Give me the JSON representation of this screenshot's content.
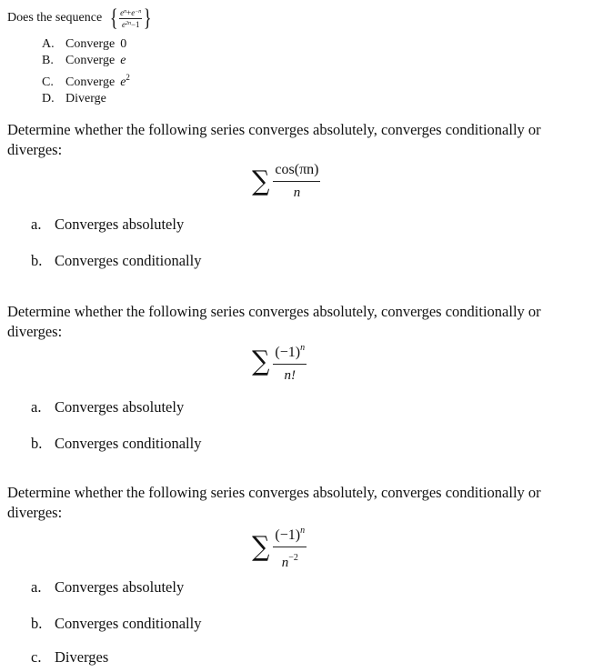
{
  "question1": {
    "stem": "Does the sequence",
    "sequence": {
      "numerator_term1": "e",
      "numerator_term1_exp": "n",
      "numerator_op": "+",
      "numerator_term2": "e",
      "numerator_term2_exp": "−n",
      "denominator_term": "e",
      "denominator_exp": "2n",
      "denominator_tail": "−1"
    },
    "options": [
      {
        "letter": "A.",
        "label": "Converge",
        "math": "0",
        "sup": ""
      },
      {
        "letter": "B.",
        "label": "Converge",
        "math": "e",
        "sup": ""
      },
      {
        "letter": "C.",
        "label": "Converge",
        "math": "e",
        "sup": "2"
      },
      {
        "letter": "D.",
        "label": "Diverge",
        "math": "",
        "sup": ""
      }
    ]
  },
  "question2": {
    "stem": "Determine whether the following series converges absolutely, converges conditionally or diverges:",
    "sigma": "∑",
    "numerator": "cos(πn)",
    "numerator_sup": "",
    "denominator": "n",
    "denominator_sup": "",
    "choices": [
      {
        "letter": "a.",
        "label": "Converges absolutely"
      },
      {
        "letter": "b.",
        "label": "Converges conditionally"
      }
    ]
  },
  "question3": {
    "stem": "Determine whether the following series converges absolutely, converges conditionally or diverges:",
    "sigma": "∑",
    "numerator": "(−1)",
    "numerator_sup": "n",
    "denominator": "n!",
    "denominator_sup": "",
    "choices": [
      {
        "letter": "a.",
        "label": "Converges absolutely"
      },
      {
        "letter": "b.",
        "label": "Converges conditionally"
      }
    ]
  },
  "question4": {
    "stem": "Determine whether the following series converges absolutely, converges conditionally or diverges:",
    "sigma": "∑",
    "numerator": "(−1)",
    "numerator_sup": "n",
    "denominator": "n",
    "denominator_sup": "−2",
    "choices": [
      {
        "letter": "a.",
        "label": "Converges absolutely"
      },
      {
        "letter": "b.",
        "label": "Converges conditionally"
      },
      {
        "letter": "c.",
        "label": "Diverges"
      }
    ]
  }
}
